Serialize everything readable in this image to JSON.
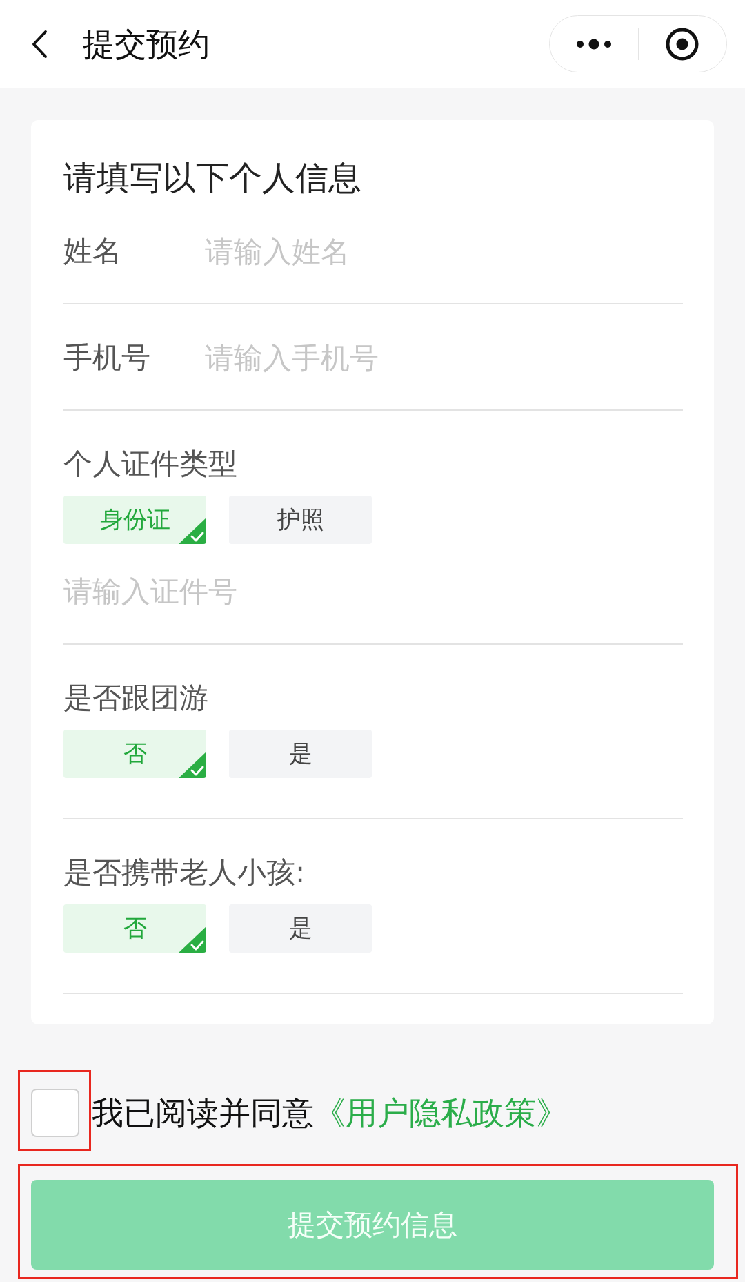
{
  "nav": {
    "title": "提交预约"
  },
  "form": {
    "heading": "请填写以下个人信息",
    "fields": [
      {
        "kind": "text",
        "label": "姓名",
        "placeholder": "请输入姓名"
      },
      {
        "kind": "text",
        "label": "手机号",
        "placeholder": "请输入手机号"
      },
      {
        "kind": "choice",
        "label": "个人证件类型",
        "options": [
          {
            "label": "身份证",
            "selected": true
          },
          {
            "label": "护照",
            "selected": false
          }
        ],
        "placeholder": "请输入证件号"
      },
      {
        "kind": "choice",
        "label": "是否跟团游",
        "options": [
          {
            "label": "否",
            "selected": true
          },
          {
            "label": "是",
            "selected": false
          }
        ]
      },
      {
        "kind": "choice",
        "label": "是否携带老人小孩:",
        "options": [
          {
            "label": "否",
            "selected": true
          },
          {
            "label": "是",
            "selected": false
          }
        ]
      }
    ]
  },
  "agreement": {
    "checked": false,
    "text": "我已阅读并同意",
    "link": "《用户隐私政策》",
    "highlighted": true
  },
  "submit": {
    "label": "提交预约信息",
    "disabled": true,
    "highlighted": true
  }
}
